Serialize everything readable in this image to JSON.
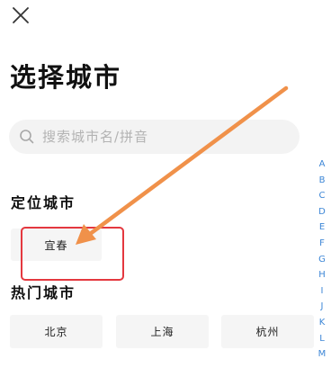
{
  "header": {
    "close_icon": "close-icon",
    "title": "选择城市"
  },
  "search": {
    "icon": "search-icon",
    "placeholder": "搜索城市名/拼音",
    "value": ""
  },
  "location_section": {
    "title": "定位城市",
    "city": "宜春"
  },
  "hot_section": {
    "title": "热门城市",
    "cities": [
      "北京",
      "上海",
      "杭州"
    ]
  },
  "alphabet_index": [
    "A",
    "B",
    "C",
    "D",
    "E",
    "F",
    "G",
    "H",
    "I",
    "J",
    "K",
    "L",
    "M"
  ],
  "colors": {
    "accent": "#3c86d6",
    "annotation_arrow": "#f0914a",
    "annotation_box": "#e4383f",
    "chip_background": "#f5f5f5",
    "search_background": "#f3f3f3"
  }
}
